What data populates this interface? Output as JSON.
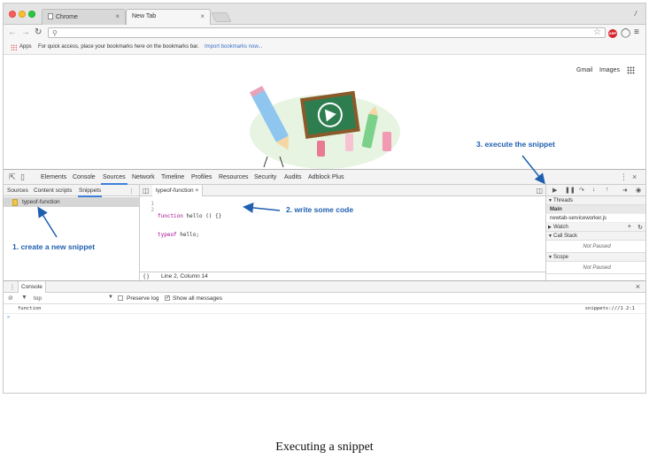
{
  "browser": {
    "tabs": [
      {
        "label": "Chrome"
      },
      {
        "label": "New Tab"
      }
    ],
    "profile_glyph": "/",
    "bookmarks": {
      "apps_label": "Apps",
      "message": "For quick access, place your bookmarks here on the bookmarks bar.",
      "import_link": "Import bookmarks now..."
    },
    "extension_abp_label": "ABP"
  },
  "ntp": {
    "gmail_label": "Gmail",
    "images_label": "Images"
  },
  "devtools": {
    "main_tabs": [
      "Elements",
      "Console",
      "Sources",
      "Network",
      "Timeline",
      "Profiles",
      "Resources",
      "Security",
      "Audits",
      "Adblock Plus"
    ],
    "selected_tab": "Sources",
    "navigator": {
      "tabs": [
        "Sources",
        "Content scripts",
        "Snippets"
      ],
      "selected_tab": "Snippets",
      "snippet_name": "typeof-function"
    },
    "editor": {
      "tab_label": "typeof-function",
      "lines": [
        {
          "num": "1",
          "keyword": "function",
          "rest": " hello () {}"
        },
        {
          "num": "2",
          "keyword": "typeof",
          "rest": " hello;"
        }
      ],
      "status": "Line 2, Column 14"
    },
    "debugger": {
      "threads_label": "Threads",
      "thread_main": "Main",
      "thread_worker": "newtab-serviceworker.js",
      "watch_label": "Watch",
      "call_stack_label": "Call Stack",
      "call_stack_state": "Not Paused",
      "scope_label": "Scope",
      "scope_state": "Not Paused"
    },
    "console": {
      "tab_label": "Console",
      "context": "top",
      "preserve_log_label": "Preserve log",
      "preserve_log_checked": false,
      "show_all_label": "Show all messages",
      "show_all_checked": true,
      "output_value": "function",
      "output_source": "snippets:///1 2:1",
      "prompt": ">"
    }
  },
  "annotations": {
    "step1": "1. create a new snippet",
    "step2": "2. write some code",
    "step3": "3. execute the snippet"
  },
  "caption": "Executing a snippet",
  "colors": {
    "annotation": "#1f5fb0",
    "tab_highlight": "#3e7fd8",
    "keyword": "#aa0d91"
  }
}
